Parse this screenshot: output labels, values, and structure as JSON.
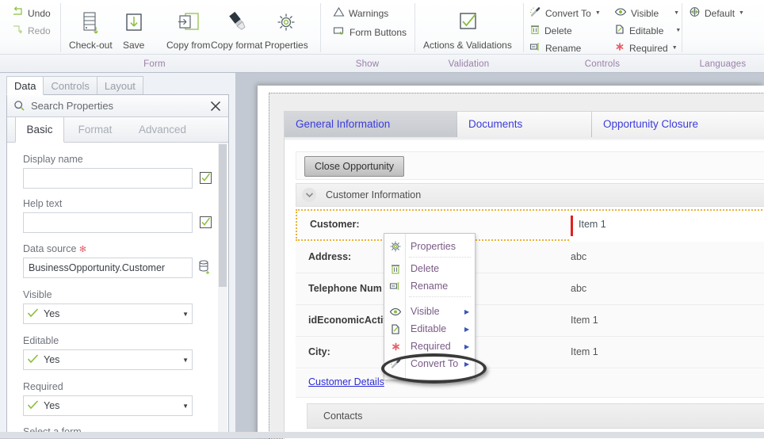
{
  "ribbon": {
    "quick": [
      {
        "label": "Undo",
        "icon": "undo-arrow-icon"
      },
      {
        "label": "Redo",
        "icon": "redo-arrow-icon"
      }
    ],
    "groups": [
      {
        "caption": "Form",
        "buttons": [
          {
            "label": "Check-out",
            "icon": "checkout-icon"
          },
          {
            "label": "Save",
            "icon": "save-down-arrow-icon"
          },
          {
            "label": "Copy from",
            "icon": "copy-from-icon"
          },
          {
            "label": "Copy format",
            "icon": "format-painter-icon"
          },
          {
            "label": "Properties",
            "icon": "gear-icon"
          }
        ]
      },
      {
        "caption": "Show",
        "items": [
          {
            "label": "Warnings",
            "icon": "warning-triangle-icon"
          },
          {
            "label": "Form Buttons",
            "icon": "form-buttons-icon"
          }
        ]
      },
      {
        "caption": "Validation",
        "buttons": [
          {
            "label": "Actions & Validations",
            "icon": "checkmark-box-icon"
          }
        ]
      },
      {
        "caption": "Controls",
        "items": [
          {
            "label": "Convert To",
            "icon": "magic-wand-icon",
            "dropdown": true
          },
          {
            "label": "Delete",
            "icon": "trash-icon"
          },
          {
            "label": "Rename",
            "icon": "rename-icon"
          },
          {
            "label": "Visible",
            "icon": "eye-icon",
            "dropdown": true
          },
          {
            "label": "Editable",
            "icon": "editable-pencil-icon",
            "dropdown": true
          },
          {
            "label": "Required",
            "icon": "required-asterisk-icon",
            "dropdown": true
          }
        ]
      },
      {
        "caption": "Languages",
        "items": [
          {
            "label": "Default",
            "icon": "globe-icon",
            "dropdown": true
          }
        ]
      }
    ]
  },
  "left_panel": {
    "tabs": [
      {
        "label": "Data",
        "active": true
      },
      {
        "label": "Controls",
        "active": false
      },
      {
        "label": "Layout",
        "active": false
      }
    ],
    "search": {
      "placeholder": "Search Properties",
      "icon": "search-icon",
      "close_icon": "close-icon"
    },
    "sub_tabs": [
      {
        "label": "Basic",
        "active": true
      },
      {
        "label": "Format",
        "active": false
      },
      {
        "label": "Advanced",
        "active": false
      }
    ],
    "fields": [
      {
        "label": "Display name",
        "type": "text",
        "value": "",
        "required": false,
        "has_check": true
      },
      {
        "label": "Help text",
        "type": "text",
        "value": "",
        "required": false,
        "has_check": true
      },
      {
        "label": "Data source",
        "type": "text",
        "value": "BusinessOpportunity.Customer",
        "required": true,
        "has_db_icon": true
      },
      {
        "label": "Visible",
        "type": "combo",
        "value": "Yes"
      },
      {
        "label": "Editable",
        "type": "combo",
        "value": "Yes"
      },
      {
        "label": "Required",
        "type": "combo",
        "value": "Yes"
      },
      {
        "label": "Select a form",
        "type": "partial"
      }
    ]
  },
  "form_designer": {
    "tabs": [
      {
        "label": "General Information",
        "active": true
      },
      {
        "label": "Documents",
        "active": false
      },
      {
        "label": "Opportunity Closure",
        "active": false
      }
    ],
    "action_button": "Close Opportunity",
    "section": {
      "title": "Customer Information",
      "collapse_icon": "chevron-down-icon"
    },
    "rows": [
      {
        "label": "Customer:",
        "value": "Item 1",
        "selected": true
      },
      {
        "label": "Address:",
        "value": "abc",
        "selected": false
      },
      {
        "label": "Telephone Num",
        "value": "abc",
        "selected": false
      },
      {
        "label": "idEconomicActiv",
        "value": "Item 1",
        "selected": false
      },
      {
        "label": "City:",
        "value": "Item 1",
        "selected": false
      }
    ],
    "link": "Customer Details",
    "next_section": "Contacts"
  },
  "context_menu": {
    "items": [
      {
        "label": "Properties",
        "icon": "gear-icon",
        "submenu": false
      },
      {
        "label": "Delete",
        "icon": "trash-icon",
        "submenu": false
      },
      {
        "label": "Rename",
        "icon": "rename-icon",
        "submenu": false
      },
      {
        "label": "Visible",
        "icon": "eye-icon",
        "submenu": true
      },
      {
        "label": "Editable",
        "icon": "editable-pencil-icon",
        "submenu": true
      },
      {
        "label": "Required",
        "icon": "required-asterisk-icon",
        "submenu": true
      },
      {
        "label": "Convert To",
        "icon": "magic-wand-icon",
        "submenu": true,
        "highlighted": true
      }
    ]
  },
  "colors": {
    "group_caption": "#9a7fa8",
    "menu_text": "#7a5b86",
    "tab_link": "#3b3bdd",
    "selection_outline": "#e9b33a",
    "cursor_red": "#e02020",
    "accent_green": "#8cbe3f",
    "required_red": "#e8606a"
  }
}
